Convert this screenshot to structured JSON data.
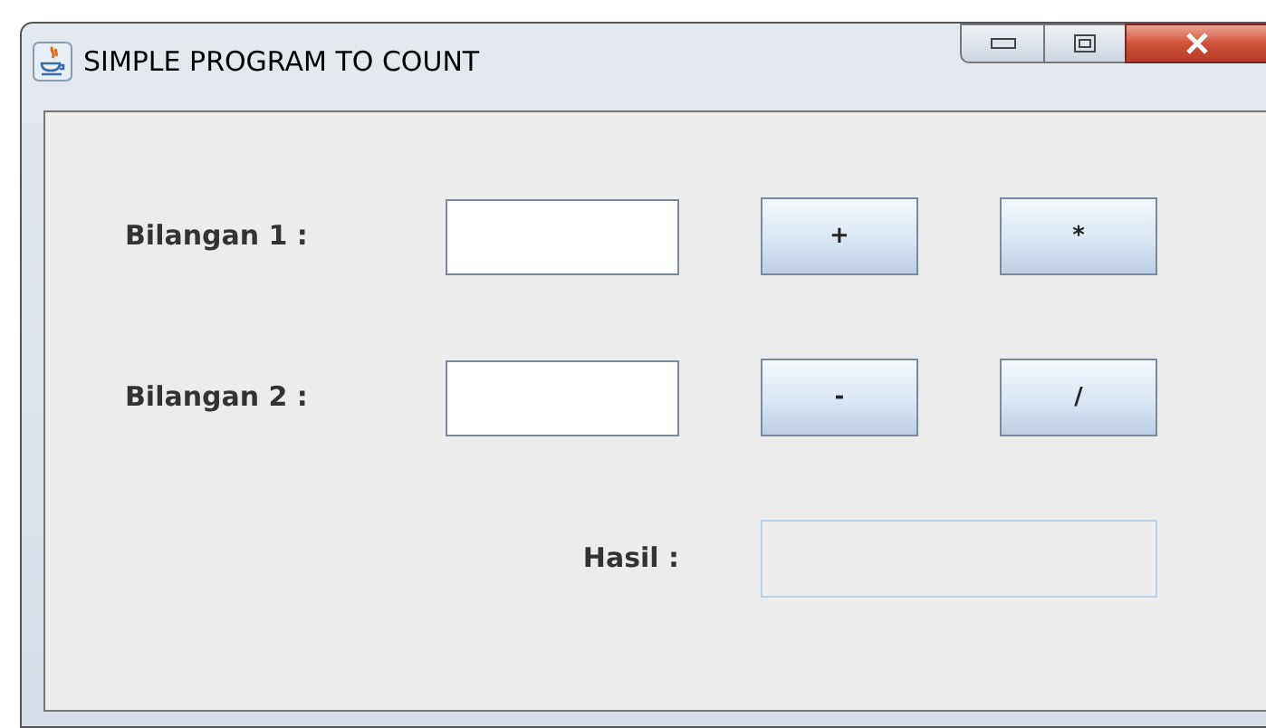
{
  "window": {
    "title": "SIMPLE PROGRAM TO COUNT"
  },
  "inputs": [
    {
      "label": "Bilangan 1 :"
    },
    {
      "label": "Bilangan 2 :"
    }
  ],
  "operator_buttons": [
    [
      "+",
      "*"
    ],
    [
      "-",
      "/"
    ]
  ],
  "result": {
    "label": "Hasil :",
    "disabled": true
  }
}
